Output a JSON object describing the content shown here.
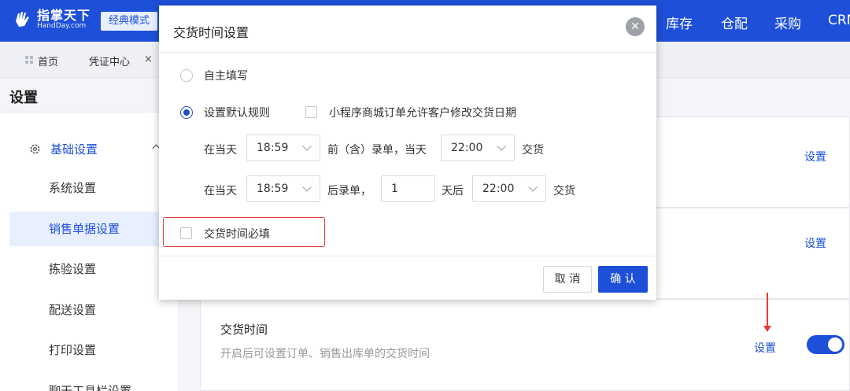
{
  "brand": {
    "logo_cn": "指掌天下",
    "logo_en": "HandDay.com",
    "mode_label": "经典模式"
  },
  "top_nav": [
    "库存",
    "仓配",
    "采购",
    "CRM"
  ],
  "tabs": [
    {
      "label": "首页"
    },
    {
      "label": "凭证中心"
    }
  ],
  "page_title": "设置",
  "sidebar": {
    "section": "基础设置",
    "items": [
      "系统设置",
      "销售单据设置",
      "拣验设置",
      "配送设置",
      "打印设置",
      "聊天工具栏设置"
    ],
    "active": "销售单据设置"
  },
  "cards": [
    {
      "link": "设置"
    },
    {
      "link": "设置"
    },
    {
      "title": "交货时间",
      "desc": "开启后可设置订单、销售出库单的交货时间",
      "link": "设置",
      "toggle_on": true
    }
  ],
  "modal": {
    "title": "交货时间设置",
    "option_manual": "自主填写",
    "option_rule": "设置默认规则",
    "allow_customer_edit": "小程序商城订单允许客户修改交货日期",
    "rule1": {
      "prefix": "在当天",
      "time": "18:59",
      "mid": "前（含）录单，当天",
      "deliver_time": "22:00",
      "suffix": "交货"
    },
    "rule2": {
      "prefix": "在当天",
      "time": "18:59",
      "mid": "后录单，",
      "days": "1",
      "days_suffix": "天后",
      "deliver_time": "22:00",
      "suffix": "交货"
    },
    "required_label": "交货时间必填",
    "cancel_label": "取 消",
    "ok_label": "确 认"
  },
  "colors": {
    "primary": "#1d4fd8",
    "highlight": "#e53935"
  }
}
